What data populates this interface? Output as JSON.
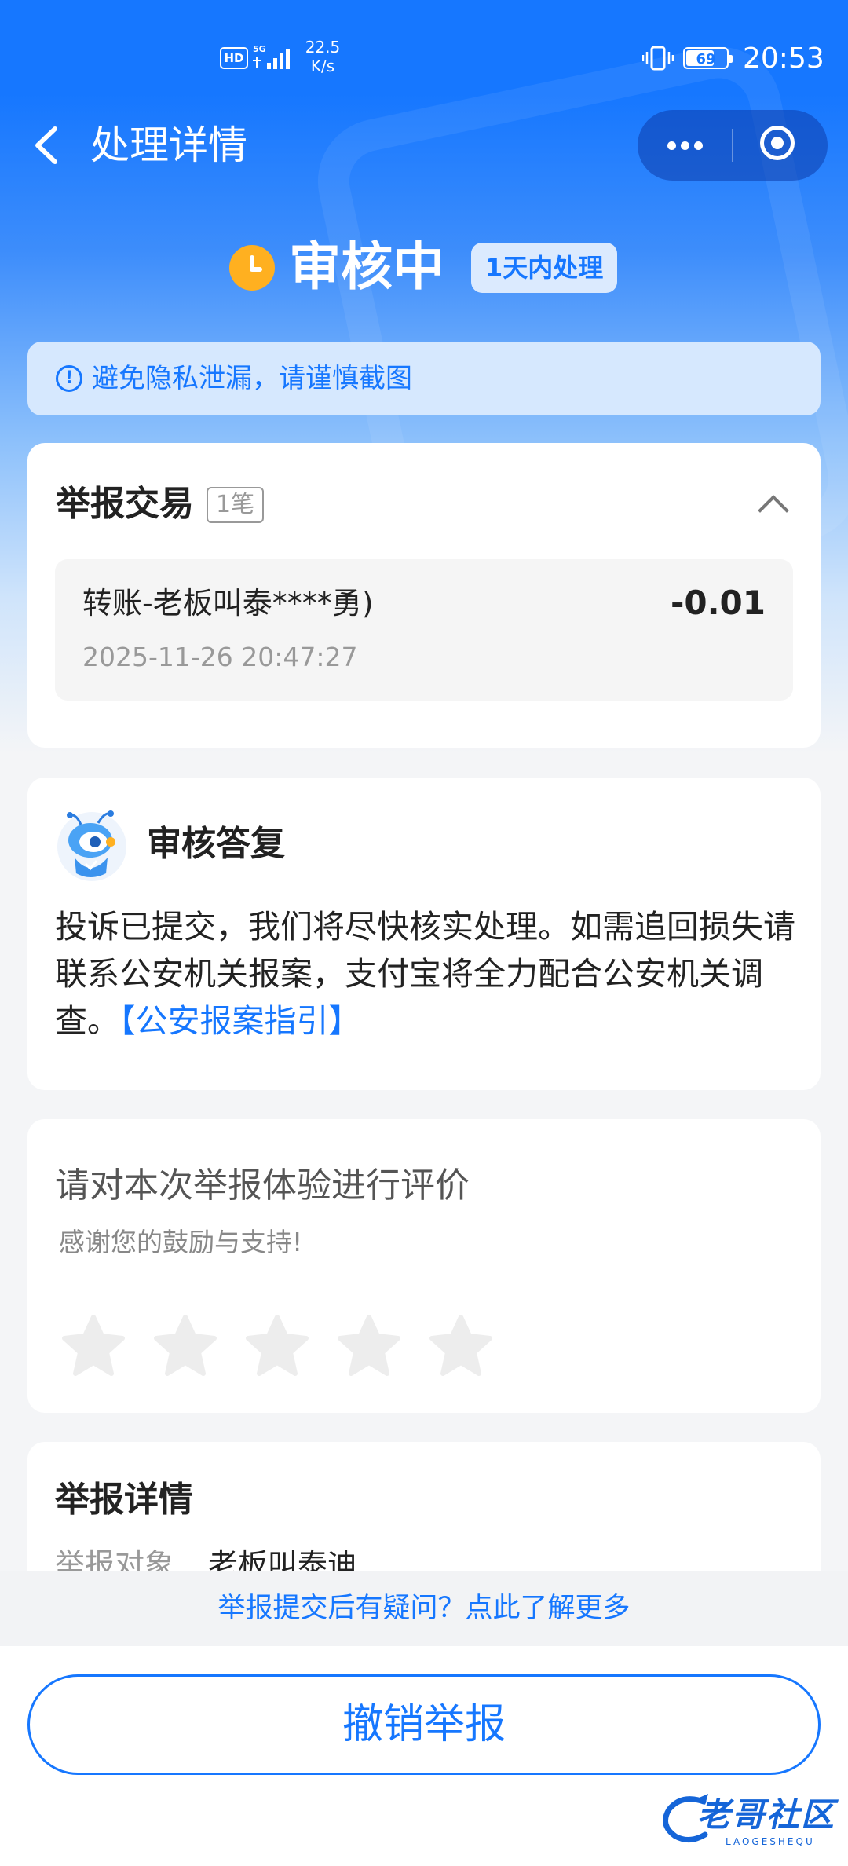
{
  "status_bar": {
    "hd": "HD",
    "network": "5G",
    "speed_value": "22.5",
    "speed_unit": "K/s",
    "battery": "69",
    "battery_level": 0.69,
    "time": "20:53"
  },
  "nav": {
    "title": "处理详情"
  },
  "status": {
    "text": "审核中",
    "badge": "1天内处理"
  },
  "notice": {
    "icon": "!",
    "text": "避免隐私泄漏，请谨慎截图"
  },
  "trade": {
    "title": "举报交易",
    "count": "1笔",
    "items": [
      {
        "name": "转账-老板叫泰****勇)",
        "amount": "-0.01",
        "time": "2025-11-26 20:47:27"
      }
    ]
  },
  "reply": {
    "title": "审核答复",
    "body": "投诉已提交，我们将尽快核实处理。如需追回损失请联系公安机关报案，支付宝将全力配合公安机关调查。",
    "link": "【公安报案指引】"
  },
  "rating": {
    "title": "请对本次举报体验进行评价",
    "subtitle": "感谢您的鼓励与支持!",
    "max_stars": 5,
    "value": 0
  },
  "detail": {
    "title": "举报详情",
    "label": "举报对象",
    "value": "老板叫泰迪"
  },
  "help": {
    "text": "举报提交后有疑问？点此了解更多"
  },
  "bottom": {
    "cancel_label": "撤销举报"
  },
  "watermark": {
    "text": "老哥社区",
    "sub": "LAOGESHEQU"
  },
  "colors": {
    "accent": "#1677ff",
    "warning": "#ffb020"
  }
}
